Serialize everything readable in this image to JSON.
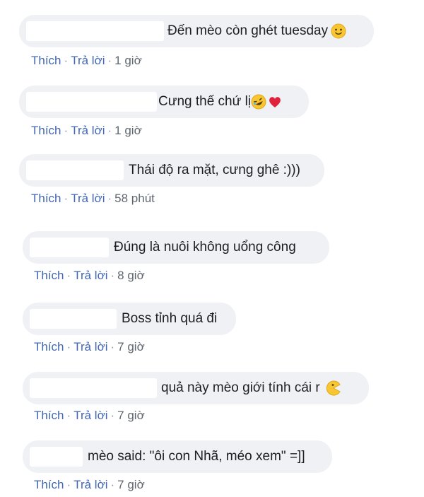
{
  "actions": {
    "like": "Thích",
    "reply": "Trả lời",
    "sep": "·"
  },
  "comments": [
    {
      "text": "Đến mèo còn ghét tuesday",
      "emoji": [
        "smile-emoji"
      ],
      "time": "1 giờ"
    },
    {
      "text": "Cưng thế chứ lị",
      "emoji": [
        "rofl-emoji",
        "heart-emoji"
      ],
      "time": "1 giờ"
    },
    {
      "text": "Thái độ ra mặt, cưng ghê :)))",
      "emoji": [],
      "time": "58 phút"
    },
    {
      "text": "Đúng là nuôi không uổng công",
      "emoji": [],
      "time": "8 giờ"
    },
    {
      "text": "Boss tỉnh quá đi",
      "emoji": [],
      "time": "7 giờ"
    },
    {
      "text": "quả này mèo giới tính cái r",
      "emoji": [
        "pacman-emoji"
      ],
      "time": "7 giờ"
    },
    {
      "text": "mèo said: \"ôi con Nhã, méo xem\" =]]",
      "emoji": [],
      "time": "7 giờ"
    }
  ],
  "colors": {
    "bubble": "#eff1f4",
    "link": "#4267b2",
    "text": "#1c1e21",
    "time": "#606770"
  }
}
